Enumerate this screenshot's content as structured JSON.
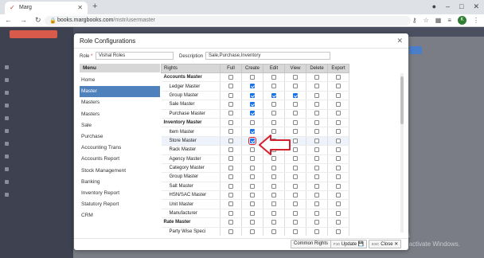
{
  "browser": {
    "tab_title": "Marg",
    "url_domain": "books.margbooks.com",
    "url_path": "/mstr/usermaster",
    "profile_initial": "K"
  },
  "app": {
    "watermark_line1": "Activate Windows",
    "watermark_line2": "Go to Settings to activate Windows."
  },
  "modal": {
    "title": "Role Configurations",
    "role_label": "Role",
    "role_value": "Vishal Roles",
    "description_label": "Description",
    "description_value": "Sale,Purchase,Inventory",
    "menu_header": "Menu",
    "menu_items": [
      {
        "label": "Home",
        "active": false
      },
      {
        "label": "Master",
        "active": true
      },
      {
        "label": "Masters",
        "active": false
      },
      {
        "label": "Masters",
        "active": false
      },
      {
        "label": "Sale",
        "active": false
      },
      {
        "label": "Purchase",
        "active": false
      },
      {
        "label": "Accounting Trans",
        "active": false
      },
      {
        "label": "Accounts Report",
        "active": false
      },
      {
        "label": "Stock Management",
        "active": false
      },
      {
        "label": "Banking",
        "active": false
      },
      {
        "label": "Inventory Report",
        "active": false
      },
      {
        "label": "Statutory Report",
        "active": false
      },
      {
        "label": "CRM",
        "active": false
      }
    ],
    "columns": [
      "Rights",
      "Full",
      "Create",
      "Edit",
      "View",
      "Delete",
      "Export"
    ],
    "rows": [
      {
        "name": "Accounts Master",
        "group": true,
        "checks": [
          false,
          false,
          false,
          false,
          false,
          false
        ]
      },
      {
        "name": "Ledger Master",
        "group": false,
        "checks": [
          false,
          true,
          false,
          false,
          false,
          false
        ]
      },
      {
        "name": "Group Master",
        "group": false,
        "checks": [
          false,
          true,
          true,
          true,
          false,
          false
        ]
      },
      {
        "name": "Sale Master",
        "group": false,
        "checks": [
          false,
          true,
          false,
          false,
          false,
          false
        ]
      },
      {
        "name": "Purchase Master",
        "group": false,
        "checks": [
          false,
          true,
          false,
          false,
          false,
          false
        ]
      },
      {
        "name": "Inventory Master",
        "group": true,
        "checks": [
          false,
          false,
          false,
          false,
          false,
          false
        ]
      },
      {
        "name": "Item Master",
        "group": false,
        "checks": [
          false,
          true,
          false,
          false,
          false,
          false
        ]
      },
      {
        "name": "Store Master",
        "group": false,
        "checks": [
          false,
          true,
          false,
          false,
          false,
          false
        ],
        "highlight": true
      },
      {
        "name": "Rack Master",
        "group": false,
        "checks": [
          false,
          false,
          false,
          false,
          false,
          false
        ]
      },
      {
        "name": "Agency Master",
        "group": false,
        "checks": [
          false,
          false,
          false,
          false,
          false,
          false
        ]
      },
      {
        "name": "Category Master",
        "group": false,
        "checks": [
          false,
          false,
          false,
          false,
          false,
          false
        ]
      },
      {
        "name": "Group Master",
        "group": false,
        "checks": [
          false,
          false,
          false,
          false,
          false,
          false
        ]
      },
      {
        "name": "Salt Master",
        "group": false,
        "checks": [
          false,
          false,
          false,
          false,
          false,
          false
        ]
      },
      {
        "name": "HSN/SAC Master",
        "group": false,
        "checks": [
          false,
          false,
          false,
          false,
          false,
          false
        ]
      },
      {
        "name": "Unit Master",
        "group": false,
        "checks": [
          false,
          false,
          false,
          false,
          false,
          false
        ]
      },
      {
        "name": "Manufacturer",
        "group": false,
        "checks": [
          false,
          false,
          false,
          false,
          false,
          false
        ]
      },
      {
        "name": "Rate Master",
        "group": true,
        "checks": [
          false,
          false,
          false,
          false,
          false,
          false
        ]
      },
      {
        "name": "Party Wise Speci",
        "group": false,
        "checks": [
          false,
          false,
          false,
          false,
          false,
          false
        ]
      }
    ],
    "buttons": {
      "common_rights": "Common Rights",
      "update_key": "F10",
      "update": "Update",
      "close_key": "ESC",
      "close": "Close"
    }
  }
}
